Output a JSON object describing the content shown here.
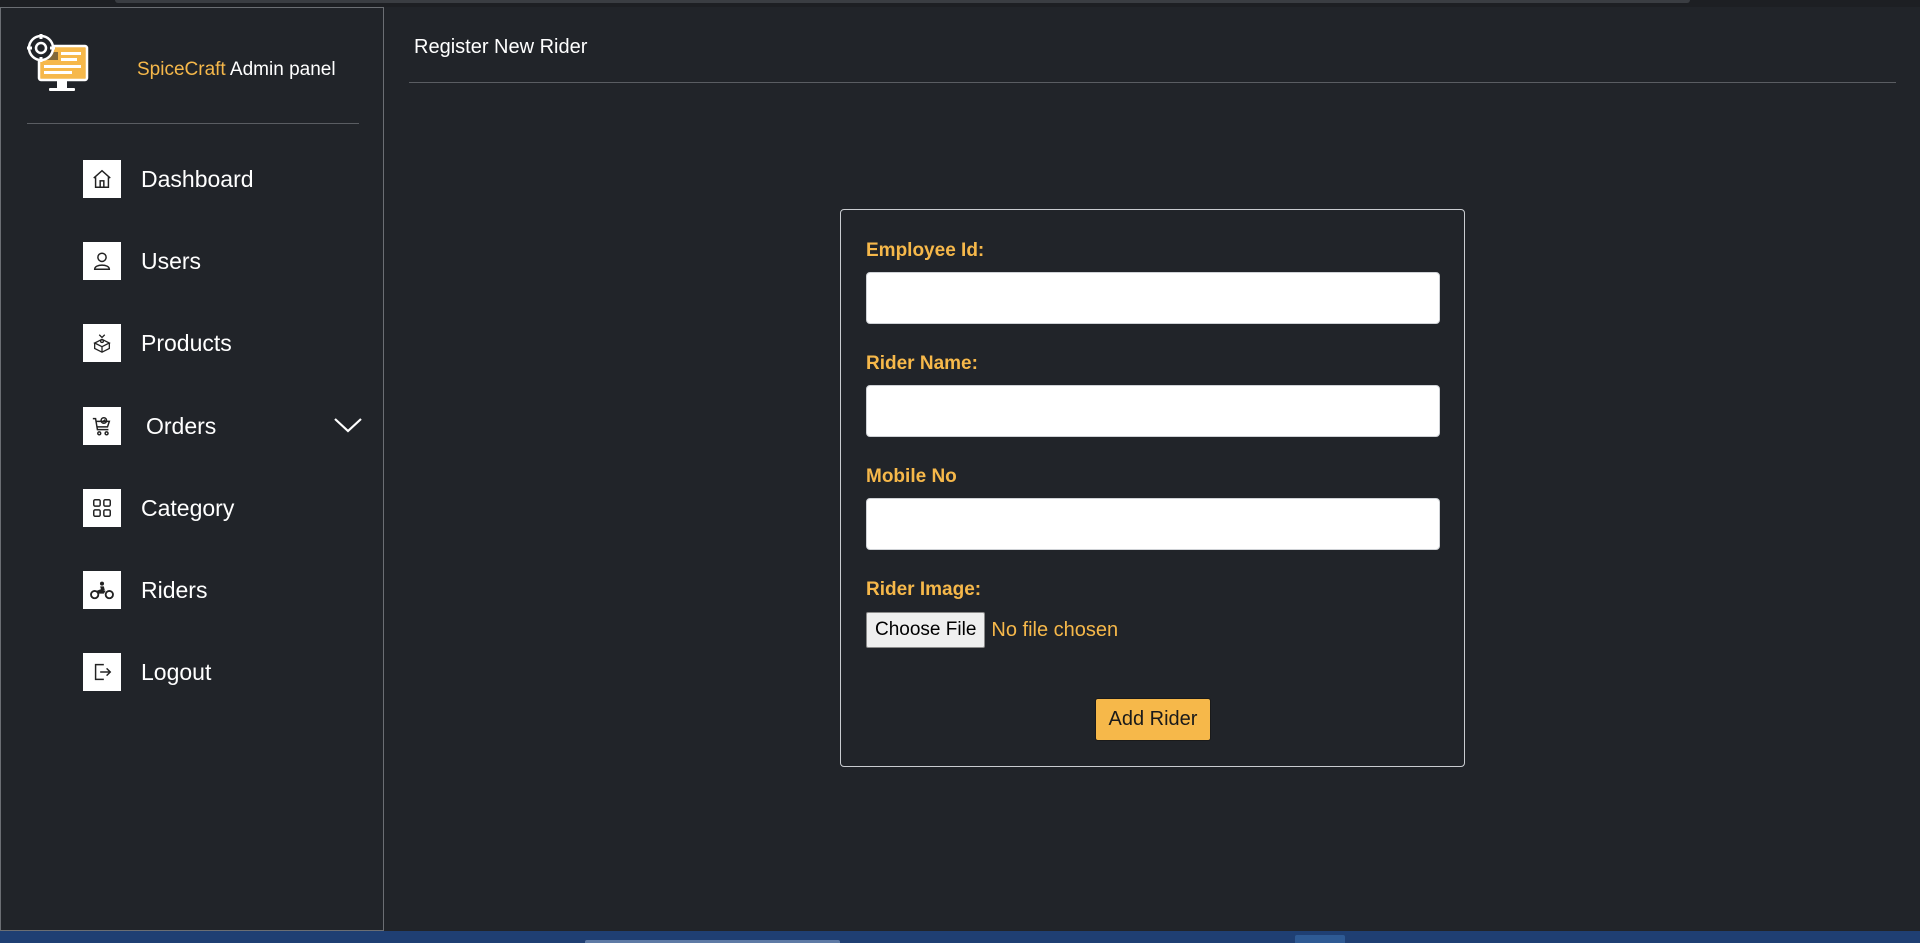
{
  "brand": {
    "accent_name": "SpiceCraft",
    "suffix": " Admin panel",
    "accent_color": "#f6b84a"
  },
  "sidebar": {
    "items": [
      {
        "label": "Dashboard",
        "icon": "home-icon"
      },
      {
        "label": "Users",
        "icon": "user-icon"
      },
      {
        "label": "Products",
        "icon": "package-icon"
      },
      {
        "label": "Orders",
        "icon": "shopping-cart-icon",
        "expandable": true
      },
      {
        "label": "Category",
        "icon": "grid-icon"
      },
      {
        "label": "Riders",
        "icon": "motorcycle-icon"
      },
      {
        "label": "Logout",
        "icon": "logout-icon"
      }
    ]
  },
  "header": {
    "title": "Register New Rider"
  },
  "form": {
    "employee_id": {
      "label": "Employee Id:",
      "value": ""
    },
    "rider_name": {
      "label": "Rider Name:",
      "value": ""
    },
    "mobile_no": {
      "label": "Mobile No",
      "value": ""
    },
    "rider_image": {
      "label": "Rider Image:",
      "button_label": "Choose File",
      "status": "No file chosen"
    },
    "submit_label": "Add Rider"
  },
  "colors": {
    "background": "#212429",
    "accent": "#f6b84a",
    "text": "#ffffff"
  }
}
